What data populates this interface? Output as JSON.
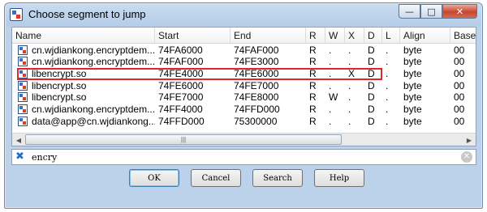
{
  "window": {
    "title": "Choose segment to jump",
    "controls": {
      "minimize": "—",
      "maximize": "□",
      "close": "✕"
    }
  },
  "table": {
    "columns": [
      "Name",
      "Start",
      "End",
      "R",
      "W",
      "X",
      "D",
      "L",
      "Align",
      "Base"
    ],
    "rows": [
      {
        "name": "cn.wjdiankong.encryptdem...",
        "start": "74FA6000",
        "end": "74FAF000",
        "r": "R",
        "w": ".",
        "x": ".",
        "d": "D",
        "l": ".",
        "align": "byte",
        "base": "00"
      },
      {
        "name": "cn.wjdiankong.encryptdem...",
        "start": "74FAF000",
        "end": "74FE3000",
        "r": "R",
        "w": ".",
        "x": ".",
        "d": "D",
        "l": ".",
        "align": "byte",
        "base": "00"
      },
      {
        "name": "libencrypt.so",
        "start": "74FE4000",
        "end": "74FE6000",
        "r": "R",
        "w": ".",
        "x": "X",
        "d": "D",
        "l": ".",
        "align": "byte",
        "base": "00"
      },
      {
        "name": "libencrypt.so",
        "start": "74FE6000",
        "end": "74FE7000",
        "r": "R",
        "w": ".",
        "x": ".",
        "d": "D",
        "l": ".",
        "align": "byte",
        "base": "00"
      },
      {
        "name": "libencrypt.so",
        "start": "74FE7000",
        "end": "74FE8000",
        "r": "R",
        "w": "W",
        "x": ".",
        "d": "D",
        "l": ".",
        "align": "byte",
        "base": "00"
      },
      {
        "name": "cn.wjdiankong.encryptdem...",
        "start": "74FF4000",
        "end": "74FFD000",
        "r": "R",
        "w": ".",
        "x": ".",
        "d": "D",
        "l": ".",
        "align": "byte",
        "base": "00"
      },
      {
        "name": "data@app@cn.wjdiankong...",
        "start": "74FFD000",
        "end": "75300000",
        "r": "R",
        "w": ".",
        "x": ".",
        "d": "D",
        "l": ".",
        "align": "byte",
        "base": "00"
      }
    ],
    "scrollbar": {
      "left_arrow": "◀",
      "right_arrow": "▶",
      "thumb_grip": "|||"
    }
  },
  "filter": {
    "icon": "✖",
    "value": "encry",
    "clear": "✕"
  },
  "buttons": {
    "ok": "OK",
    "cancel": "Cancel",
    "search": "Search",
    "help": "Help"
  }
}
